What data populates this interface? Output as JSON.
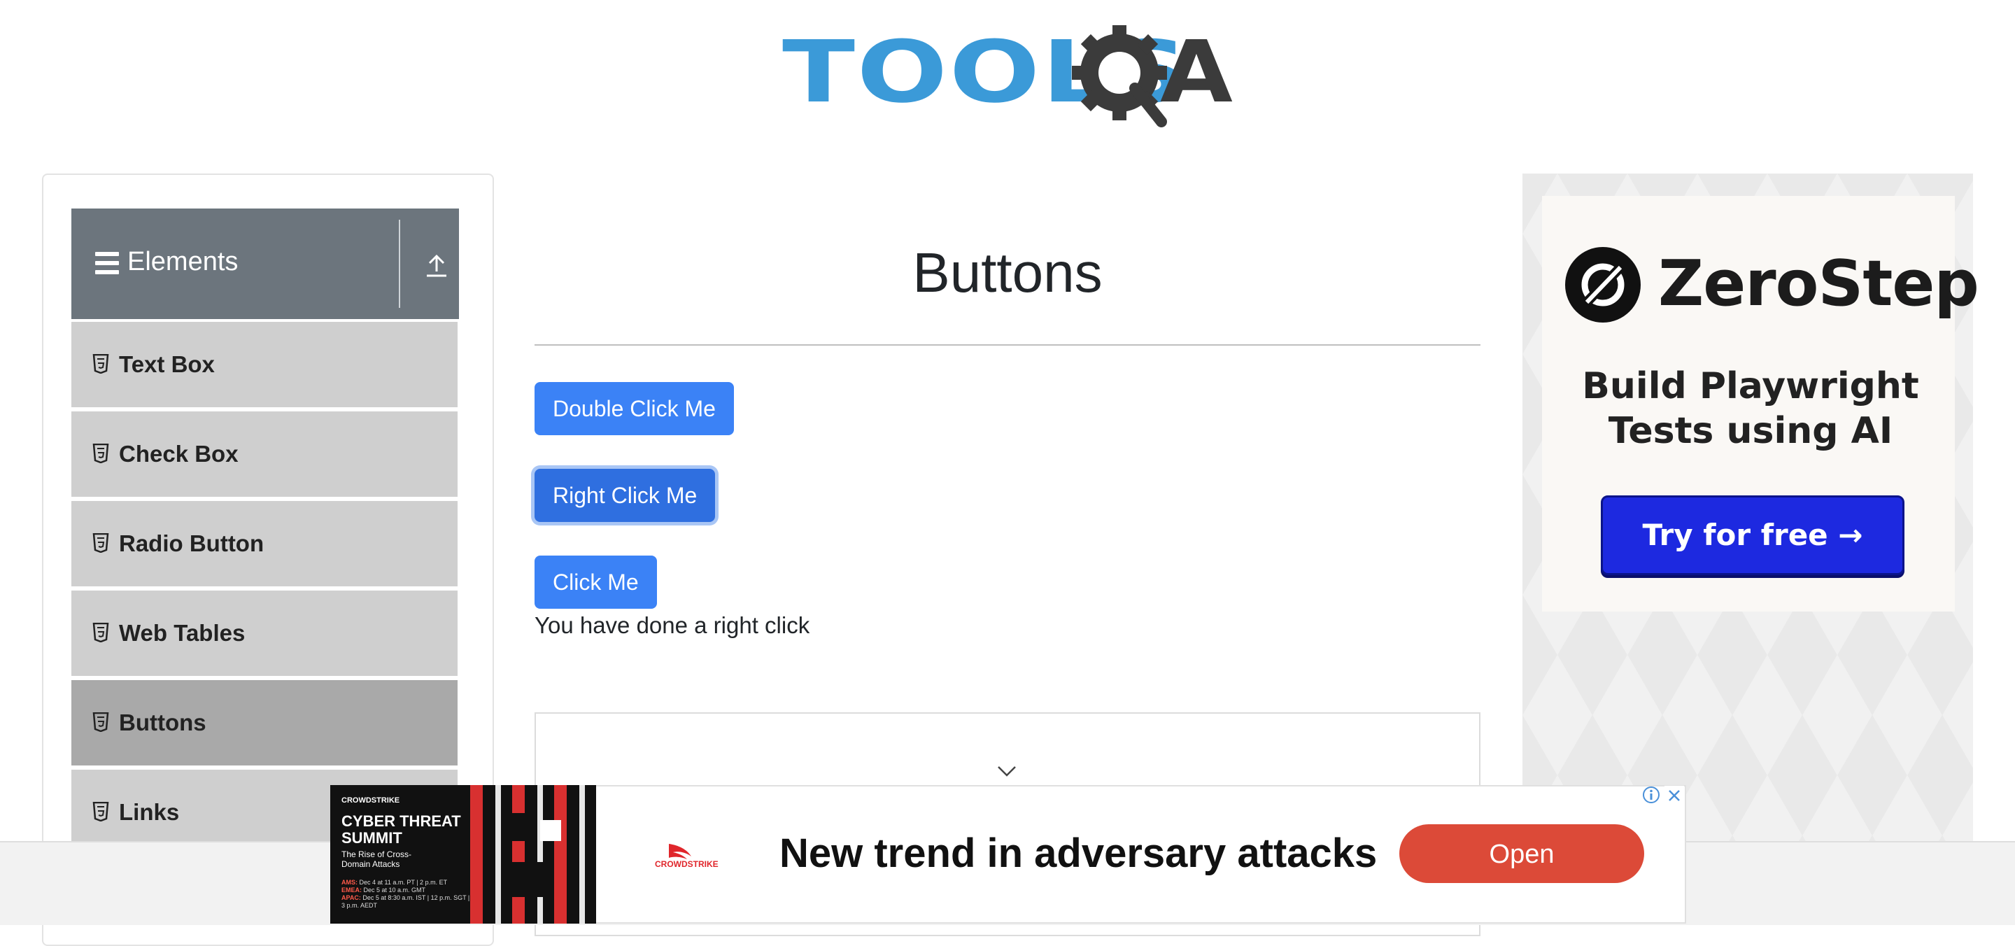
{
  "logo": {
    "tools": "TOOLS",
    "a": "A"
  },
  "sidebar": {
    "group_title": "Elements",
    "items": [
      {
        "label": "Text Box"
      },
      {
        "label": "Check Box"
      },
      {
        "label": "Radio Button"
      },
      {
        "label": "Web Tables"
      },
      {
        "label": "Buttons",
        "active": true
      },
      {
        "label": "Links"
      }
    ]
  },
  "main": {
    "title": "Buttons",
    "buttons": {
      "double_click": "Double Click Me",
      "right_click": "Right Click Me",
      "click": "Click Me"
    },
    "result_message": "You have done a right click"
  },
  "ad_right": {
    "brand": "ZeroStep",
    "tagline": "Build Playwright Tests using AI",
    "cta": "Try for free →",
    "colors": {
      "cta": "#1d29e0"
    }
  },
  "banner_ad": {
    "brand_small": "CROWDSTRIKE",
    "event_title": "CYBER THREAT SUMMIT",
    "event_subtitle": "The Rise of Cross-Domain Attacks",
    "dates": [
      {
        "region": "AMS:",
        "text": "Dec 4 at 11 a.m. PT | 2 p.m. ET"
      },
      {
        "region": "EMEA:",
        "text": "Dec 5 at 10 a.m. GMT"
      },
      {
        "region": "APAC:",
        "text": "Dec 5 at 8:30 a.m. IST | 12 p.m. SGT | 3 p.m. AEDT"
      }
    ],
    "logo_text": "CROWDSTRIKE",
    "headline": "New trend in adversary attacks",
    "cta": "Open",
    "colors": {
      "cta": "#dc4a38"
    }
  },
  "colors": {
    "primary_button": "#3b82f6",
    "sidebar_header": "#6c757d",
    "menu_item": "#cfcfcf",
    "menu_item_active": "#a9a9a9"
  }
}
